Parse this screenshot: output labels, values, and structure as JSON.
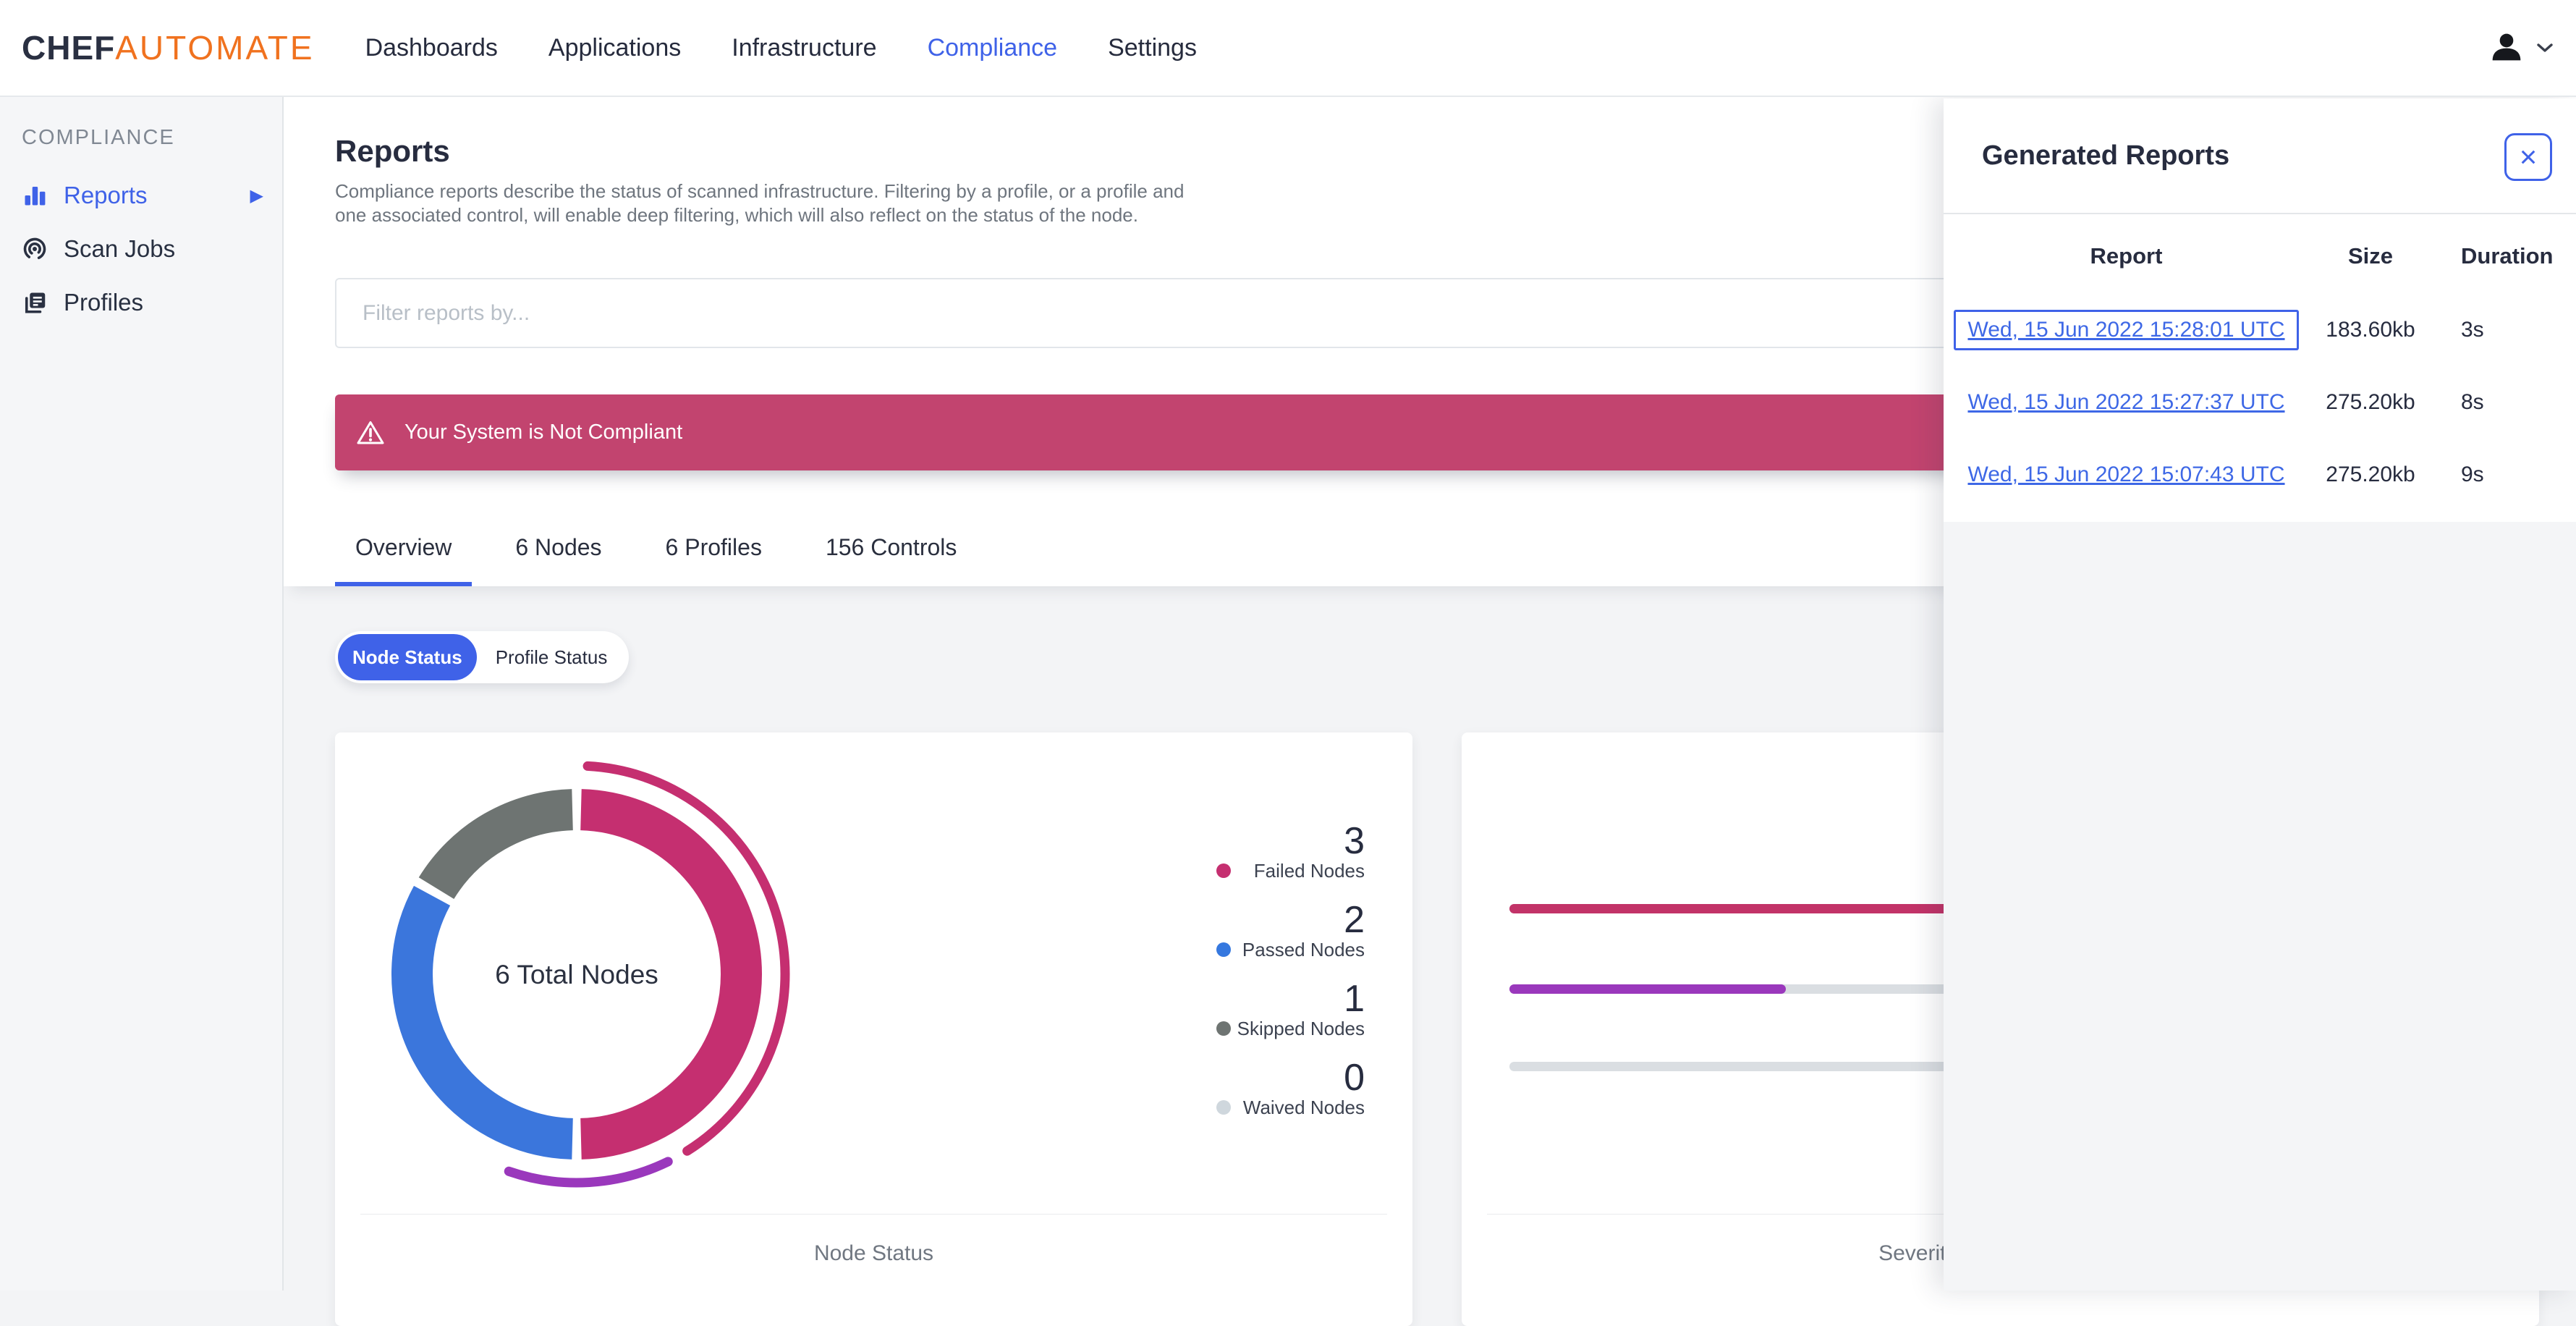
{
  "brand": {
    "chef": "CHEF",
    "automate": "AUTOMATE"
  },
  "nav": {
    "items": [
      {
        "label": "Dashboards",
        "active": false
      },
      {
        "label": "Applications",
        "active": false
      },
      {
        "label": "Infrastructure",
        "active": false
      },
      {
        "label": "Compliance",
        "active": true
      },
      {
        "label": "Settings",
        "active": false
      }
    ]
  },
  "sidebar": {
    "section_label": "COMPLIANCE",
    "items": [
      {
        "label": "Reports",
        "icon": "bar-chart-icon",
        "active": true,
        "has_submenu": true
      },
      {
        "label": "Scan Jobs",
        "icon": "scan-target-icon",
        "active": false,
        "has_submenu": false
      },
      {
        "label": "Profiles",
        "icon": "profiles-stack-icon",
        "active": false,
        "has_submenu": false
      }
    ],
    "submenu_arrow": "▶"
  },
  "page": {
    "title": "Reports",
    "description_line1": "Compliance reports describe the status of scanned infrastructure. Filtering by a profile, or a profile and",
    "description_line2": "one associated control, will enable deep filtering, which will also reflect on the status of the node.",
    "filter_placeholder": "Filter reports by...",
    "banner_text": "Your System is Not Compliant",
    "tabs": [
      {
        "label": "Overview",
        "active": true
      },
      {
        "label": "6 Nodes",
        "active": false
      },
      {
        "label": "6 Profiles",
        "active": false
      },
      {
        "label": "156 Controls",
        "active": false
      }
    ],
    "status_toggle": [
      {
        "label": "Node Status",
        "active": true
      },
      {
        "label": "Profile Status",
        "active": false
      }
    ]
  },
  "node_status_card": {
    "center_label": "6 Total Nodes",
    "footer_label": "Node Status",
    "legend": [
      {
        "value": "3",
        "label": "Failed Nodes",
        "color": "#C52F70"
      },
      {
        "value": "2",
        "label": "Passed Nodes",
        "color": "#3578DF"
      },
      {
        "value": "1",
        "label": "Skipped Nodes",
        "color": "#6E7472"
      },
      {
        "value": "0",
        "label": "Waived Nodes",
        "color": "#CFD7DD"
      }
    ]
  },
  "severity_card": {
    "footer_label": "Severity of Node Failures"
  },
  "generated_reports": {
    "title": "Generated Reports",
    "close_glyph": "×",
    "columns": {
      "report": "Report",
      "size": "Size",
      "duration": "Duration"
    },
    "rows": [
      {
        "report": "Wed, 15 Jun 2022 15:28:01 UTC",
        "size": "183.60kb",
        "duration": "3s",
        "focused": true
      },
      {
        "report": "Wed, 15 Jun 2022 15:27:37 UTC",
        "size": "275.20kb",
        "duration": "8s",
        "focused": false
      },
      {
        "report": "Wed, 15 Jun 2022 15:07:43 UTC",
        "size": "275.20kb",
        "duration": "9s",
        "focused": false
      }
    ]
  },
  "colors": {
    "primary_blue": "#3F62E8",
    "link_blue": "#3E68E6",
    "banner_pink": "#C2446F",
    "failed_pink": "#C52F70",
    "passed_blue": "#3B76DC",
    "skipped_gray": "#6E7472",
    "waived_gray": "#CFD7DD",
    "outer_purple": "#9A38BC",
    "brand_orange": "#F0721F",
    "bar_track_gray": "#DADEE2"
  },
  "chart_data": [
    {
      "type": "pie",
      "subtype": "donut",
      "title": "Node Status",
      "center_label": "6 Total Nodes",
      "total": 6,
      "segments": [
        {
          "label": "Failed Nodes",
          "value": 3,
          "color": "#C52F70"
        },
        {
          "label": "Passed Nodes",
          "value": 2,
          "color": "#3B76DC"
        },
        {
          "label": "Skipped Nodes",
          "value": 1,
          "color": "#6E7472"
        },
        {
          "label": "Waived Nodes",
          "value": 0,
          "color": "#CFD7DD"
        }
      ],
      "start_angle_deg": 0,
      "direction": "clockwise",
      "segment_gap_deg": 3,
      "outer_arcs": [
        {
          "start_deg": 3,
          "end_deg": 148,
          "color": "#C52F70"
        },
        {
          "start_deg": 154,
          "end_deg": 199,
          "color": "#9A38BC"
        }
      ],
      "legend_position": "right"
    },
    {
      "type": "bar",
      "orientation": "horizontal",
      "title": "Severity of Node Failures",
      "bars": [
        {
          "fill_fraction": 1.0,
          "color": "#C23368"
        },
        {
          "fill_fraction": 0.286,
          "color": "#9A38BC"
        },
        {
          "fill_fraction": 0.0,
          "color": "#DADEE2"
        }
      ],
      "track_color": "#DADEE2",
      "axis_labels_visible": false
    }
  ]
}
